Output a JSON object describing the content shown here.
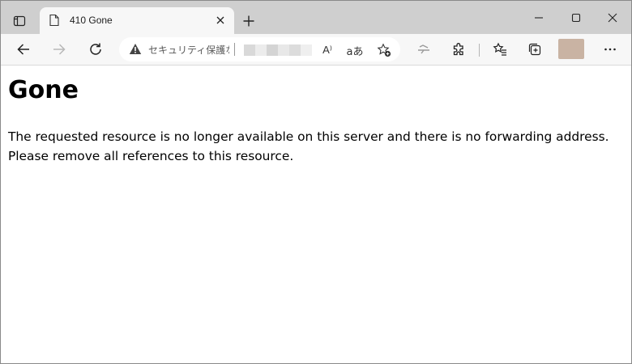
{
  "tab": {
    "title": "410 Gone"
  },
  "addressbar": {
    "security_label": "セキュリティ保護なし",
    "readaloud_glyph": "A⁾",
    "translate_glyph": "aあ"
  },
  "page": {
    "heading": "Gone",
    "message_line1": "The requested resource is no longer available on this server and there is no forwarding address.",
    "message_line2": "Please remove all references to this resource."
  },
  "colors": {
    "tabstrip_bg": "#cfcfcf",
    "toolbar_bg": "#f7f7f7",
    "profile_avatar": "#c9b3a3"
  },
  "icons": [
    "tab-actions-icon",
    "page-icon",
    "close-icon",
    "plus-icon",
    "minimize-icon",
    "maximize-icon",
    "close-window-icon",
    "back-arrow-icon",
    "forward-arrow-icon",
    "refresh-icon",
    "warning-icon",
    "read-aloud-icon",
    "translate-icon",
    "add-favorite-icon",
    "media-icon",
    "extensions-icon",
    "favorites-icon",
    "collections-icon",
    "more-icon"
  ]
}
